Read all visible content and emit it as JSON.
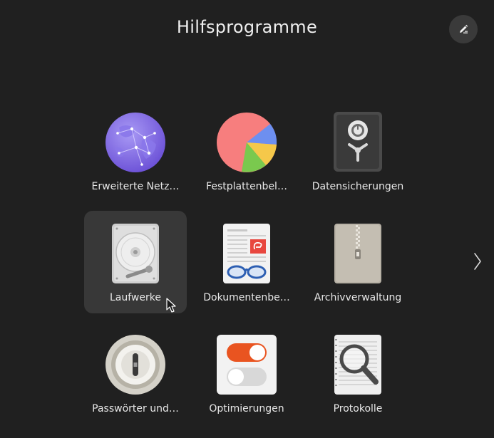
{
  "folder": {
    "title": "Hilfsprogramme",
    "edit_icon": "pencil-icon",
    "next_icon": "chevron-right-icon"
  },
  "apps": [
    {
      "label": "Erweiterte Netz…",
      "icon": "globe-network-icon"
    },
    {
      "label": "Festplattenbel…",
      "icon": "pie-chart-icon"
    },
    {
      "label": "Datensicherungen",
      "icon": "safe-vault-icon"
    },
    {
      "label": "Laufwerke",
      "icon": "hard-disk-icon",
      "selected": true
    },
    {
      "label": "Dokumentenbe…",
      "icon": "document-glasses-icon"
    },
    {
      "label": "Archivverwaltung",
      "icon": "zip-archive-icon"
    },
    {
      "label": "Passwörter und…",
      "icon": "keyhole-icon"
    },
    {
      "label": "Optimierungen",
      "icon": "toggle-switches-icon"
    },
    {
      "label": "Protokolle",
      "icon": "magnifier-log-icon"
    }
  ],
  "colors": {
    "background": "#202020",
    "selected_tile": "#383838",
    "toggle_on": "#e95420"
  }
}
